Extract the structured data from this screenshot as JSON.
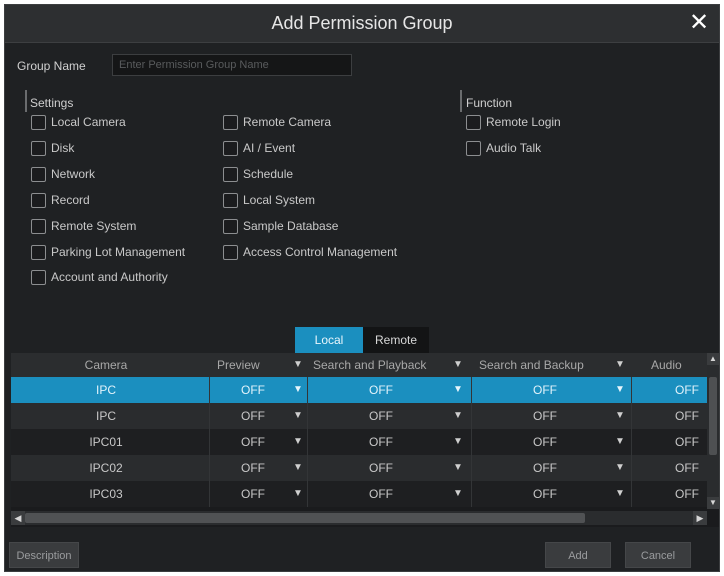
{
  "dialog": {
    "title": "Add Permission Group",
    "close_glyph": "✕"
  },
  "group_name": {
    "label": "Group Name",
    "placeholder": "Enter Permission Group Name",
    "value": ""
  },
  "settings": {
    "title": "Settings",
    "items": [
      {
        "label": "Local Camera",
        "checked": false
      },
      {
        "label": "Remote Camera",
        "checked": false
      },
      {
        "label": "Disk",
        "checked": false
      },
      {
        "label": "AI / Event",
        "checked": false
      },
      {
        "label": "Network",
        "checked": false
      },
      {
        "label": "Schedule",
        "checked": false
      },
      {
        "label": "Record",
        "checked": false
      },
      {
        "label": "Local System",
        "checked": false
      },
      {
        "label": "Remote System",
        "checked": false
      },
      {
        "label": "Sample Database",
        "checked": false
      },
      {
        "label": "Parking Lot Management",
        "checked": false
      },
      {
        "label": "Access Control Management",
        "checked": false
      },
      {
        "label": "Account and Authority",
        "checked": false
      }
    ]
  },
  "function": {
    "title": "Function",
    "items": [
      {
        "label": "Remote Login",
        "checked": false
      },
      {
        "label": "Audio Talk",
        "checked": false
      }
    ]
  },
  "tabs": [
    {
      "label": "Local",
      "active": true
    },
    {
      "label": "Remote",
      "active": false
    }
  ],
  "table": {
    "columns": [
      "Camera",
      "Preview",
      "Search and Playback",
      "Search and Backup",
      "Audio"
    ],
    "rows": [
      {
        "camera": "IPC",
        "values": [
          "OFF",
          "OFF",
          "OFF",
          "OFF"
        ],
        "selected": true
      },
      {
        "camera": "IPC",
        "values": [
          "OFF",
          "OFF",
          "OFF",
          "OFF"
        ],
        "selected": false
      },
      {
        "camera": "IPC01",
        "values": [
          "OFF",
          "OFF",
          "OFF",
          "OFF"
        ],
        "selected": false
      },
      {
        "camera": "IPC02",
        "values": [
          "OFF",
          "OFF",
          "OFF",
          "OFF"
        ],
        "selected": false
      },
      {
        "camera": "IPC03",
        "values": [
          "OFF",
          "OFF",
          "OFF",
          "OFF"
        ],
        "selected": false
      }
    ]
  },
  "icons": {
    "chevron": "chevron-down-icon",
    "scroll_up": "arrow-up-icon",
    "scroll_down": "arrow-down-icon",
    "scroll_left": "arrow-left-icon",
    "scroll_right": "arrow-right-icon"
  },
  "footer": {
    "description_label": "Description",
    "add_label": "Add",
    "cancel_label": "Cancel"
  },
  "colors": {
    "accent": "#1b8fbf",
    "background": "#1f2123",
    "header": "#2d2f31"
  }
}
